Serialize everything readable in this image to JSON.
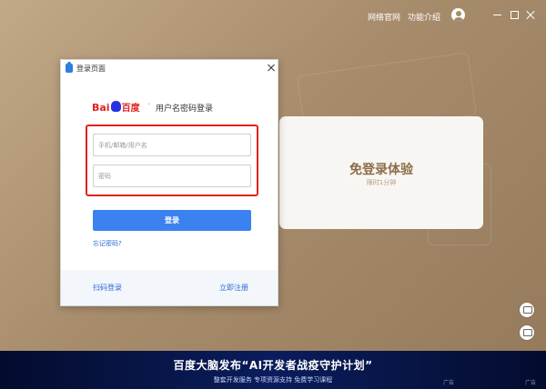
{
  "topbar": {
    "links": [
      "网络官网",
      "功能介绍"
    ]
  },
  "dialog": {
    "title": "登录页面",
    "logo": {
      "latin": "Bai",
      "cn": "百度"
    },
    "heading": "用户名密码登录",
    "username": {
      "placeholder": "手机/邮箱/用户名",
      "value": ""
    },
    "password": {
      "placeholder": "密码",
      "value": ""
    },
    "login_label": "登录",
    "forgot_label": "忘记密码?",
    "qr_login_label": "扫码登录",
    "register_label": "立即注册"
  },
  "experience": {
    "title": "免登录体验",
    "subtitle": "限时1分钟"
  },
  "banner": {
    "title": "百度大脑发布“AI开发者战疫守护计划”",
    "subtitle": "整套开发服务  专项资源支持  免费学习课程",
    "ad_labels": [
      "广告",
      "广告"
    ]
  },
  "icons": [
    "avatar-icon",
    "minimize-icon",
    "maximize-icon",
    "close-icon",
    "comment-icon",
    "chat-icon",
    "baidu-paw-icon"
  ],
  "colors": {
    "background": "#a88d6d",
    "accent": "#3b82f0",
    "highlight": "#e0221d",
    "brand_red": "#e0221d",
    "brand_blue": "#2932e1"
  }
}
